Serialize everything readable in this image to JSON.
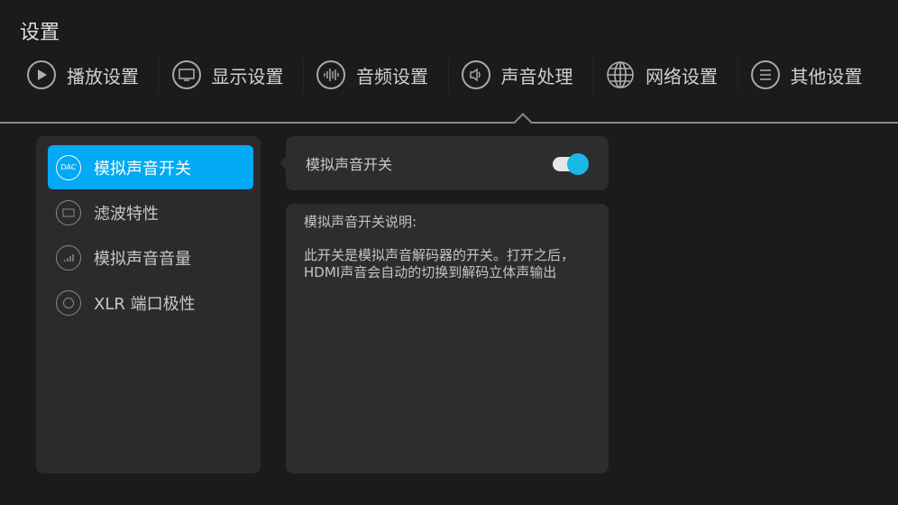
{
  "title": "设置",
  "tabs": [
    {
      "label": "播放设置",
      "icon": "play-icon"
    },
    {
      "label": "显示设置",
      "icon": "monitor-icon"
    },
    {
      "label": "音频设置",
      "icon": "audio-wave-icon"
    },
    {
      "label": "声音处理",
      "icon": "speaker-icon",
      "active": true
    },
    {
      "label": "网络设置",
      "icon": "globe-icon"
    },
    {
      "label": "其他设置",
      "icon": "menu-icon"
    }
  ],
  "sidebar": {
    "items": [
      {
        "label": "模拟声音开关",
        "icon_text": "DAC",
        "selected": true
      },
      {
        "label": "滤波特性",
        "icon": "filter-icon"
      },
      {
        "label": "模拟声音音量",
        "icon": "volume-bars-icon"
      },
      {
        "label": "XLR 端口极性",
        "icon": "polarity-icon"
      }
    ]
  },
  "setting": {
    "label": "模拟声音开关",
    "toggle_on": true,
    "accent": "#03a9f4"
  },
  "description": {
    "title": "模拟声音开关说明:",
    "body": "此开关是模拟声音解码器的开关。打开之后，\nHDMI声音会自动的切换到解码立体声输出"
  }
}
